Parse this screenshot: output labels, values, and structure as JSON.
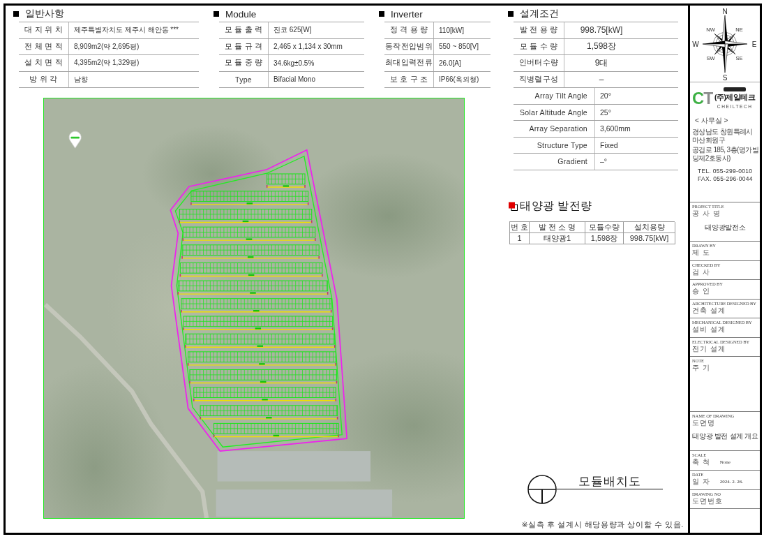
{
  "general": {
    "title": "일반사항",
    "rows": [
      {
        "label": "대 지 위 치",
        "value": "제주특별자치도 제주시 해안동 ***"
      },
      {
        "label": "전 체 면 적",
        "value": "8,909m2(약 2,695평)"
      },
      {
        "label": "설 치 면 적",
        "value": "4,395m2(약 1,329평)"
      },
      {
        "label": "방 위 각",
        "value": "남향"
      }
    ]
  },
  "module": {
    "title": "Module",
    "rows": [
      {
        "label": "모 듈 출 력",
        "value": "진코 625[W]"
      },
      {
        "label": "모 듈 규 격",
        "value": "2,465 x 1,134 x 30mm"
      },
      {
        "label": "모 듈 중 량",
        "value": "34.6kg±0.5%"
      },
      {
        "label": "Type",
        "value": "Bifacial Mono"
      }
    ]
  },
  "inverter": {
    "title": "Inverter",
    "rows": [
      {
        "label": "정 격 용 량",
        "value": "110[kW]"
      },
      {
        "label": "동작전압범위",
        "value": "550 ~ 850[V]"
      },
      {
        "label": "최대입력전류",
        "value": "26.0[A]"
      },
      {
        "label": "보 호 구 조",
        "value": "IP66(옥외형)"
      }
    ]
  },
  "design_conditions": {
    "title": "설계조건",
    "rows": [
      {
        "kind": "main",
        "label": "발 전 용 량",
        "value": "998.75[kW]"
      },
      {
        "kind": "main",
        "label": "모 듈 수 량",
        "value": "1,598장"
      },
      {
        "kind": "main",
        "label": "인버터수량",
        "value": "9대"
      },
      {
        "kind": "main",
        "label": "직병렬구성",
        "value": "–"
      },
      {
        "kind": "detail",
        "label": "Array Tilt Angle",
        "value": "20°"
      },
      {
        "kind": "detail",
        "label": "Solar Altitude Angle",
        "value": "25°"
      },
      {
        "kind": "detail",
        "label": "Array Separation",
        "value": "3,600mm"
      },
      {
        "kind": "detail",
        "label": "Structure Type",
        "value": "Fixed"
      },
      {
        "kind": "detail",
        "label": "Gradient",
        "value": "–°"
      }
    ]
  },
  "generation": {
    "title": "태양광 발전량",
    "columns": [
      "번 호",
      "발 전 소 명",
      "모듈수량",
      "설치용량"
    ],
    "rows": [
      [
        "1",
        "태양광1",
        "1,598장",
        "998.75[kW]"
      ]
    ]
  },
  "drawing_title": "모듈배치도",
  "note": "※실측 후 설계시 해당용량과 상이할 수 있음.",
  "title_block": {
    "compass": {
      "north": "N",
      "east": "E",
      "south": "S",
      "west": "W",
      "intercardinal": [
        "NW",
        "NE",
        "SW",
        "SE"
      ]
    },
    "company": {
      "mark": "CT",
      "name": "(주)제일테크",
      "roman": "CHEILTECH"
    },
    "office": "< 사무실 >",
    "address": [
      "경상남도 창원특례시 마산회원구",
      "공검로 185, 3층(명가빌딩제2호동사)"
    ],
    "tel": "TEL. 055-299-0010",
    "fax": "FAX. 055-296-0044",
    "fields": [
      {
        "kind": "title",
        "label": "PROJECT TITLE",
        "label_ko": "공 사 명",
        "value": "태양광발전소"
      },
      {
        "kind": "plain",
        "label": "DRAWN BY",
        "label_ko": "제 도"
      },
      {
        "kind": "plain",
        "label": "CHECKED BY",
        "label_ko": "검 사"
      },
      {
        "kind": "plain",
        "label": "APPROVED BY",
        "label_ko": "승 인"
      },
      {
        "kind": "plain",
        "label": "ARCHITECTURE DESIGNED BY",
        "label_ko": "건축 설계"
      },
      {
        "kind": "plain",
        "label": "MECHANICAL DESIGNED BY",
        "label_ko": "설비 설계"
      },
      {
        "kind": "plain",
        "label": "ELECTRICAL DESIGNED BY",
        "label_ko": "전기 설계"
      },
      {
        "kind": "note",
        "label": "NOTE",
        "label_ko": "주 기"
      },
      {
        "kind": "title",
        "label": "NAME OF DRAWING",
        "label_ko": "도면명",
        "value": "태양광 발전 설계 개요"
      },
      {
        "kind": "inline",
        "label": "SCALE",
        "label_ko": "축 척",
        "value": "None"
      },
      {
        "kind": "inline",
        "label": "DATE",
        "label_ko": "일 자",
        "value": "2024. 2. 26."
      },
      {
        "kind": "plain",
        "label": "DRAWING NO",
        "label_ko": "도면번호"
      }
    ]
  }
}
